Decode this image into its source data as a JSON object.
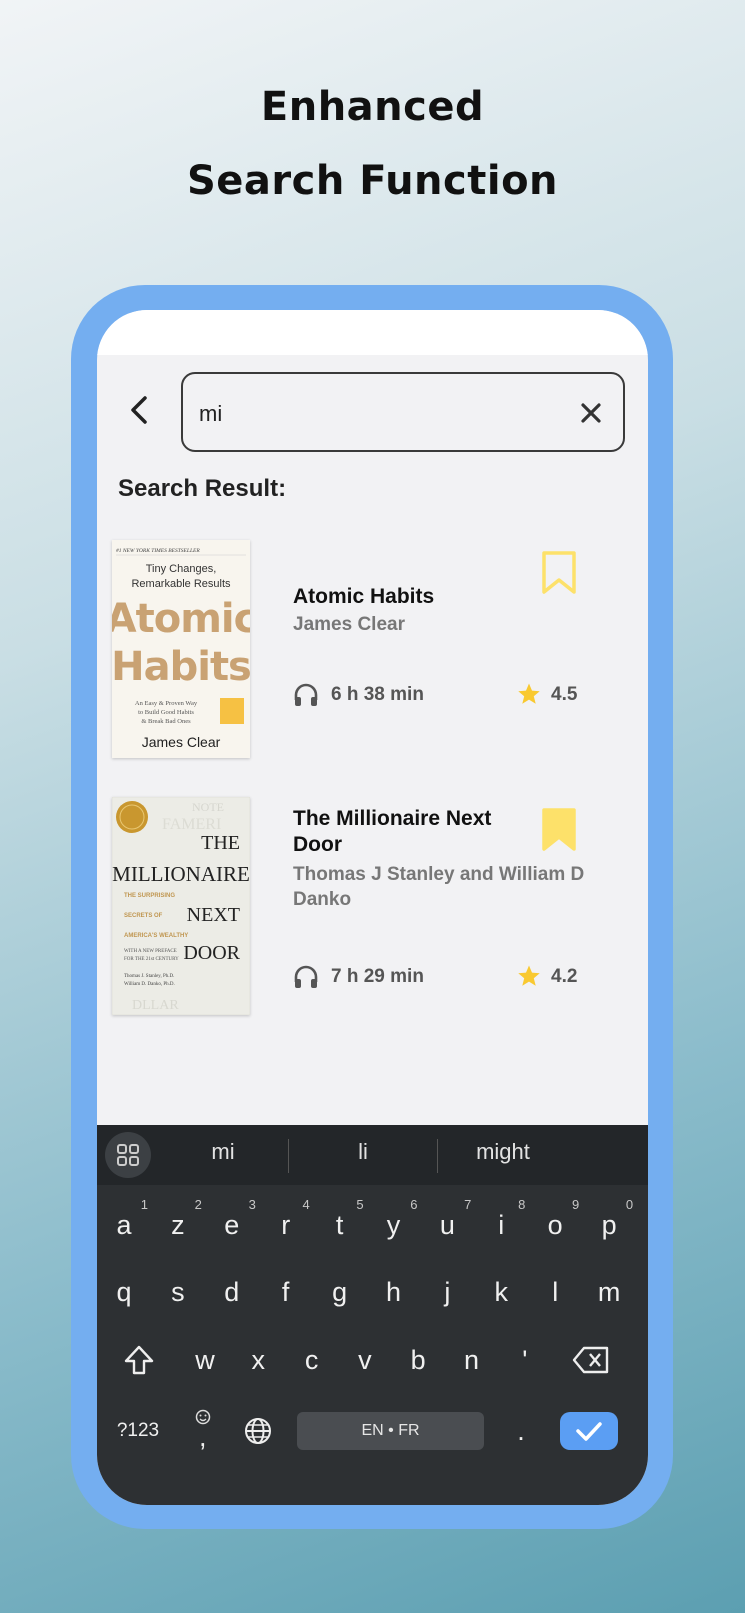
{
  "headline": {
    "line1": "Enhanced",
    "line2": "Search Function"
  },
  "search": {
    "query": "mi"
  },
  "results": {
    "title": "Search Result:",
    "books": [
      {
        "title": "Atomic Habits",
        "author": "James Clear",
        "duration": "6 h 38 min",
        "rating": "4.5",
        "bookmarked": false,
        "cover": {
          "top_banner": "#1 NEW YORK TIMES BESTSELLER",
          "tagline": "Tiny Changes, Remarkable Results",
          "title_line1": "Atomic",
          "title_line2": "Habits",
          "subtitle": "An Easy & Proven Way to Build Good Habits & Break Bad Ones",
          "author": "James Clear"
        }
      },
      {
        "title": "The Millionaire Next Door",
        "author": "Thomas J Stanley and William D Danko",
        "duration": "7 h 29 min",
        "rating": "4.2",
        "bookmarked": true,
        "cover": {
          "title_the": "THE",
          "title_main": "MILLIONAIRE",
          "title_next": "NEXT",
          "title_door": "DOOR",
          "subtitle": "THE SURPRISING SECRETS OF AMERICA'S WEALTHY",
          "note": "WITH A NEW PREFACE FOR THE 21st CENTURY",
          "authors": "Thomas J. Stanley, Ph.D. William D. Danko, Ph.D."
        }
      }
    ]
  },
  "keyboard": {
    "suggestions": [
      "mi",
      "li",
      "might"
    ],
    "row1": [
      {
        "k": "a",
        "n": "1"
      },
      {
        "k": "z",
        "n": "2"
      },
      {
        "k": "e",
        "n": "3"
      },
      {
        "k": "r",
        "n": "4"
      },
      {
        "k": "t",
        "n": "5"
      },
      {
        "k": "y",
        "n": "6"
      },
      {
        "k": "u",
        "n": "7"
      },
      {
        "k": "i",
        "n": "8"
      },
      {
        "k": "o",
        "n": "9"
      },
      {
        "k": "p",
        "n": "0"
      }
    ],
    "row2": [
      "q",
      "s",
      "d",
      "f",
      "g",
      "h",
      "j",
      "k",
      "l",
      "m"
    ],
    "row3": [
      "w",
      "x",
      "c",
      "v",
      "b",
      "n",
      "'"
    ],
    "symbols_key": "?123",
    "emoji_comma_key": ",",
    "space_label": "EN • FR",
    "period_key": "."
  },
  "colors": {
    "bookmark": "#fde16a",
    "star": "#f9c930",
    "phone_frame": "#74aef0",
    "enter_key": "#5b9ef3"
  },
  "icons": [
    "back-arrow-icon",
    "close-icon",
    "bookmark-icon",
    "headphones-icon",
    "star-icon",
    "grid-icon",
    "shift-icon",
    "backspace-icon",
    "emoji-icon",
    "globe-icon",
    "check-icon"
  ]
}
